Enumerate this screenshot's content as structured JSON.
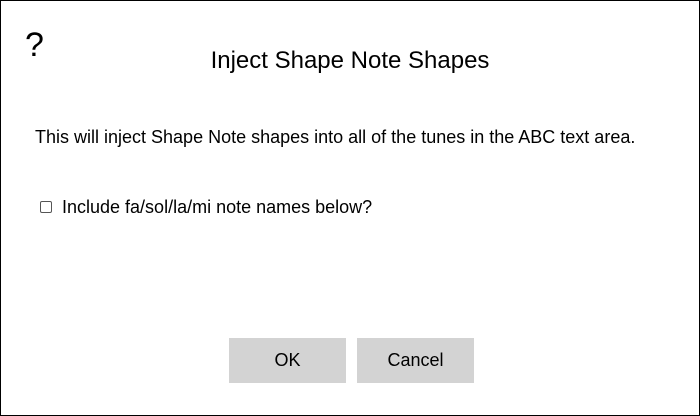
{
  "dialog": {
    "help_icon": "?",
    "title": "Inject Shape Note Shapes",
    "message": "This will inject Shape Note shapes into all of the tunes in the ABC text area.",
    "checkbox": {
      "label": "Include fa/sol/la/mi note names below?",
      "checked": false
    },
    "buttons": {
      "ok": "OK",
      "cancel": "Cancel"
    },
    "colors": {
      "button_background": "#d3d3d3",
      "border": "#000000",
      "background": "#ffffff"
    }
  }
}
